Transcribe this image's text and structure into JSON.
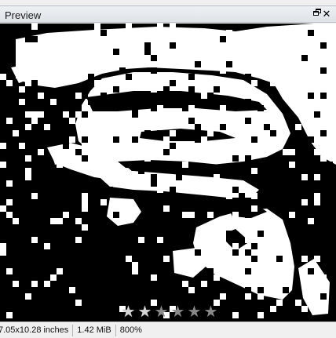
{
  "panel": {
    "title": "Preview",
    "float_icon": "restore-window-icon",
    "close_icon": "close-icon",
    "close_glyph": "✕"
  },
  "preview": {
    "image_description_icon": "image-preview",
    "rating": {
      "value": 2,
      "max": 6,
      "filled_glyph": "★",
      "empty_glyph": "★"
    }
  },
  "status": {
    "dimensions": "7.05x10.28 inches",
    "file_size": "1.42 MiB",
    "zoom": "800%"
  }
}
